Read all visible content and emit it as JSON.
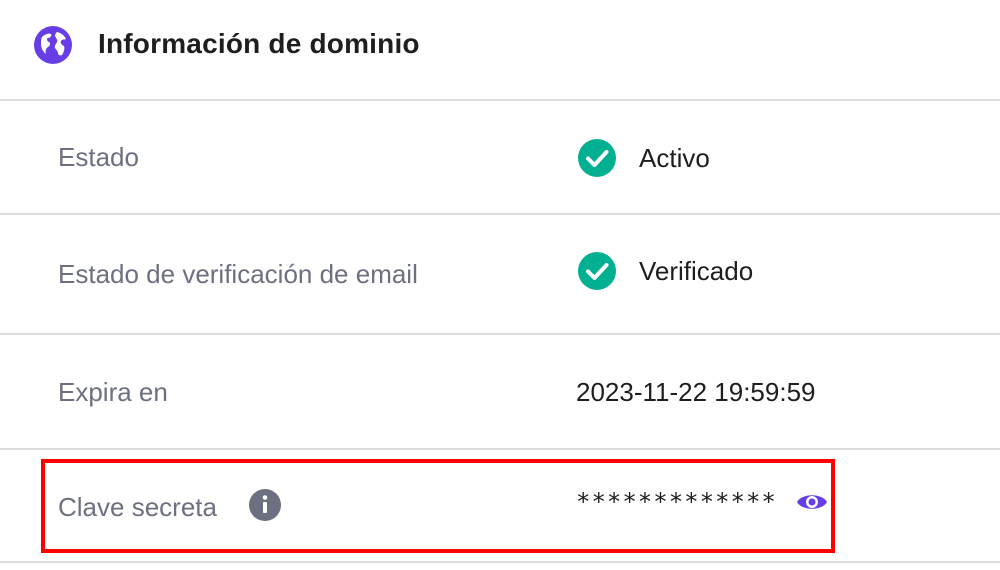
{
  "header": {
    "title": "Información de dominio",
    "icon": "globe-icon",
    "accent_color": "#673de6"
  },
  "rows": [
    {
      "label": "Estado",
      "value": "Activo",
      "status_icon": "check-circle-icon",
      "status_color": "#00b090"
    },
    {
      "label": "Estado de verificación de email",
      "value": "Verificado",
      "status_icon": "check-circle-icon",
      "status_color": "#00b090"
    },
    {
      "label": "Expira en",
      "value": "2023-11-22 19:59:59"
    },
    {
      "label": "Clave secreta",
      "value": "*************",
      "info_icon": "info-icon",
      "action_icon": "eye-icon"
    }
  ],
  "highlight_color": "#ff0000"
}
